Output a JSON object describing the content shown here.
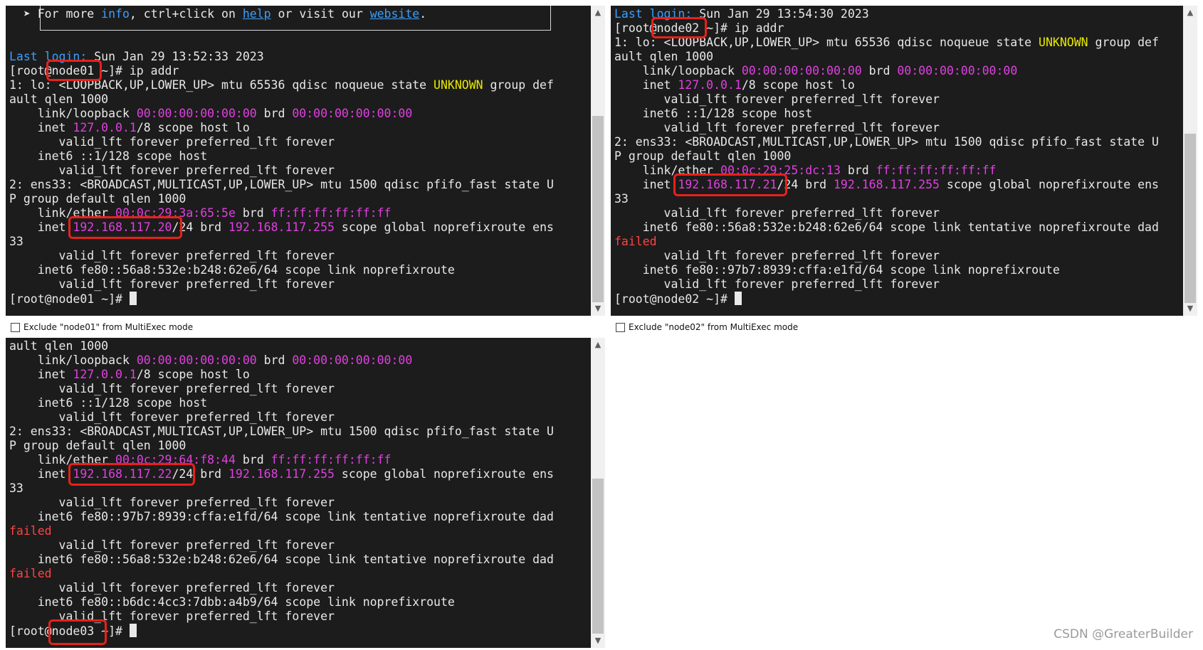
{
  "pane1": {
    "host": "node01",
    "lines": [
      [
        {
          "t": "  "
        },
        {
          "t": "➤ For more "
        },
        {
          "t": "info",
          "c": "blue"
        },
        {
          "t": ", ctrl+click on "
        },
        {
          "t": "help",
          "c": "ul"
        },
        {
          "t": " or visit our "
        },
        {
          "t": "website",
          "c": "ul"
        },
        {
          "t": "."
        }
      ],
      [],
      [],
      [
        {
          "t": "Last login:",
          "c": "blue"
        },
        {
          "t": " Sun Jan 29 13:52:33 2023"
        }
      ],
      [
        {
          "t": "[root@node01 ~]# ip addr"
        }
      ],
      [
        {
          "t": "1: lo: <LOOPBACK,UP,LOWER_UP> mtu 65536 qdisc noqueue state "
        },
        {
          "t": "UNKNOWN",
          "c": "yel"
        },
        {
          "t": " group def"
        }
      ],
      [
        {
          "t": "ault qlen 1000"
        }
      ],
      [
        {
          "t": "    link/loopback "
        },
        {
          "t": "00:00:00:00:00:00",
          "c": "mag"
        },
        {
          "t": " brd "
        },
        {
          "t": "00:00:00:00:00:00",
          "c": "mag"
        }
      ],
      [
        {
          "t": "    inet "
        },
        {
          "t": "127.0.0.1",
          "c": "mag"
        },
        {
          "t": "/8 scope host lo"
        }
      ],
      [
        {
          "t": "       valid_lft forever preferred_lft forever"
        }
      ],
      [
        {
          "t": "    inet6 ::1/128 scope host"
        }
      ],
      [
        {
          "t": "       valid_lft forever preferred_lft forever"
        }
      ],
      [
        {
          "t": "2: ens33: <BROADCAST,MULTICAST,UP,LOWER_UP> mtu 1500 qdisc pfifo_fast state U"
        }
      ],
      [
        {
          "t": "P group default qlen 1000"
        }
      ],
      [
        {
          "t": "    link/ether "
        },
        {
          "t": "00:0c:29:3a:65:5e",
          "c": "mag"
        },
        {
          "t": " brd "
        },
        {
          "t": "ff:ff:ff:ff:ff:ff",
          "c": "mag"
        }
      ],
      [
        {
          "t": "    inet "
        },
        {
          "t": "192.168.117.20",
          "c": "mag"
        },
        {
          "t": "/24 brd "
        },
        {
          "t": "192.168.117.255",
          "c": "mag"
        },
        {
          "t": " scope global noprefixroute ens"
        }
      ],
      [
        {
          "t": "33"
        }
      ],
      [
        {
          "t": "       valid_lft forever preferred_lft forever"
        }
      ],
      [
        {
          "t": "    inet6 fe80::56a8:532e:b248:62e6/64 scope link noprefixroute"
        }
      ],
      [
        {
          "t": "       valid_lft forever preferred_lft forever"
        }
      ],
      [
        {
          "t": "[root@node01 ~]# "
        },
        {
          "cursor": true
        }
      ]
    ],
    "exclude_label": "Exclude \"node01\" from MultiExec mode"
  },
  "pane2": {
    "host": "node02",
    "lines": [
      [
        {
          "t": "Last login:",
          "c": "blue"
        },
        {
          "t": " Sun Jan 29 13:54:30 2023"
        }
      ],
      [
        {
          "t": "[root@node02 ~]# ip addr"
        }
      ],
      [
        {
          "t": "1: lo: <LOOPBACK,UP,LOWER_UP> mtu 65536 qdisc noqueue state "
        },
        {
          "t": "UNKNOWN",
          "c": "yel"
        },
        {
          "t": " group def"
        }
      ],
      [
        {
          "t": "ault qlen 1000"
        }
      ],
      [
        {
          "t": "    link/loopback "
        },
        {
          "t": "00:00:00:00:00:00",
          "c": "mag"
        },
        {
          "t": " brd "
        },
        {
          "t": "00:00:00:00:00:00",
          "c": "mag"
        }
      ],
      [
        {
          "t": "    inet "
        },
        {
          "t": "127.0.0.1",
          "c": "mag"
        },
        {
          "t": "/8 scope host lo"
        }
      ],
      [
        {
          "t": "       valid_lft forever preferred_lft forever"
        }
      ],
      [
        {
          "t": "    inet6 ::1/128 scope host"
        }
      ],
      [
        {
          "t": "       valid_lft forever preferred_lft forever"
        }
      ],
      [
        {
          "t": "2: ens33: <BROADCAST,MULTICAST,UP,LOWER_UP> mtu 1500 qdisc pfifo_fast state U"
        }
      ],
      [
        {
          "t": "P group default qlen 1000"
        }
      ],
      [
        {
          "t": "    link/ether "
        },
        {
          "t": "00:0c:29:25:dc:13",
          "c": "mag"
        },
        {
          "t": " brd "
        },
        {
          "t": "ff:ff:ff:ff:ff:ff",
          "c": "mag"
        }
      ],
      [
        {
          "t": "    inet "
        },
        {
          "t": "192.168.117.21",
          "c": "mag"
        },
        {
          "t": "/24 brd "
        },
        {
          "t": "192.168.117.255",
          "c": "mag"
        },
        {
          "t": " scope global noprefixroute ens"
        }
      ],
      [
        {
          "t": "33"
        }
      ],
      [
        {
          "t": "       valid_lft forever preferred_lft forever"
        }
      ],
      [
        {
          "t": "    inet6 fe80::56a8:532e:b248:62e6/64 scope link tentative noprefixroute dad"
        }
      ],
      [
        {
          "t": "failed",
          "c": "red"
        }
      ],
      [
        {
          "t": "       valid_lft forever preferred_lft forever"
        }
      ],
      [
        {
          "t": "    inet6 fe80::97b7:8939:cffa:e1fd/64 scope link noprefixroute"
        }
      ],
      [
        {
          "t": "       valid_lft forever preferred_lft forever"
        }
      ],
      [
        {
          "t": "[root@node02 ~]# "
        },
        {
          "cursor": true
        }
      ]
    ],
    "exclude_label": "Exclude \"node02\" from MultiExec mode"
  },
  "pane3": {
    "host": "node03",
    "lines": [
      [
        {
          "t": "ault qlen 1000"
        }
      ],
      [
        {
          "t": "    link/loopback "
        },
        {
          "t": "00:00:00:00:00:00",
          "c": "mag"
        },
        {
          "t": " brd "
        },
        {
          "t": "00:00:00:00:00:00",
          "c": "mag"
        }
      ],
      [
        {
          "t": "    inet "
        },
        {
          "t": "127.0.0.1",
          "c": "mag"
        },
        {
          "t": "/8 scope host lo"
        }
      ],
      [
        {
          "t": "       valid_lft forever preferred_lft forever"
        }
      ],
      [
        {
          "t": "    inet6 ::1/128 scope host"
        }
      ],
      [
        {
          "t": "       valid_lft forever preferred_lft forever"
        }
      ],
      [
        {
          "t": "2: ens33: <BROADCAST,MULTICAST,UP,LOWER_UP> mtu 1500 qdisc pfifo_fast state U"
        }
      ],
      [
        {
          "t": "P group default qlen 1000"
        }
      ],
      [
        {
          "t": "    link/ether "
        },
        {
          "t": "00:0c:29:64:f8:44",
          "c": "mag"
        },
        {
          "t": " brd "
        },
        {
          "t": "ff:ff:ff:ff:ff:ff",
          "c": "mag"
        }
      ],
      [
        {
          "t": "    inet "
        },
        {
          "t": "192.168.117.22",
          "c": "mag"
        },
        {
          "t": "/24 brd "
        },
        {
          "t": "192.168.117.255",
          "c": "mag"
        },
        {
          "t": " scope global noprefixroute ens"
        }
      ],
      [
        {
          "t": "33"
        }
      ],
      [
        {
          "t": "       valid_lft forever preferred_lft forever"
        }
      ],
      [
        {
          "t": "    inet6 fe80::97b7:8939:cffa:e1fd/64 scope link tentative noprefixroute dad"
        }
      ],
      [
        {
          "t": "failed",
          "c": "red"
        }
      ],
      [
        {
          "t": "       valid_lft forever preferred_lft forever"
        }
      ],
      [
        {
          "t": "    inet6 fe80::56a8:532e:b248:62e6/64 scope link tentative noprefixroute dad"
        }
      ],
      [
        {
          "t": "failed",
          "c": "red"
        }
      ],
      [
        {
          "t": "       valid_lft forever preferred_lft forever"
        }
      ],
      [
        {
          "t": "    inet6 fe80::b6dc:4cc3:7dbb:a4b9/64 scope link noprefixroute"
        }
      ],
      [
        {
          "t": "       valid_lft forever preferred_lft forever"
        }
      ],
      [
        {
          "t": "[root@node03 ~]# "
        },
        {
          "cursor": true
        }
      ]
    ]
  },
  "scroll_up_icon": "▲",
  "scroll_down_icon": "▼",
  "watermark": "CSDN @GreaterBuilder"
}
